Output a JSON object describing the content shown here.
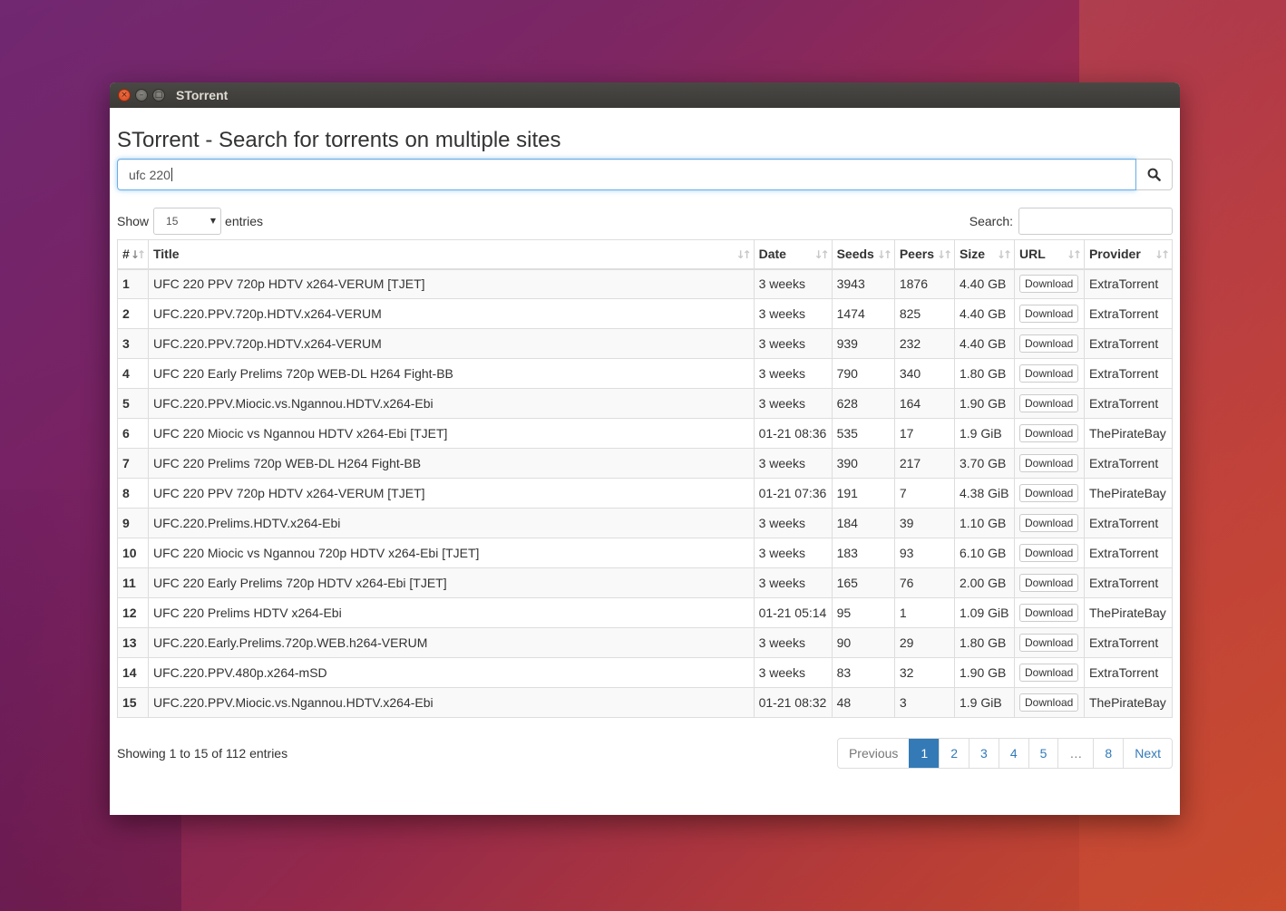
{
  "window": {
    "title": "STorrent",
    "close_glyph": "×",
    "min_glyph": "–",
    "max_glyph": "□"
  },
  "page": {
    "heading": "STorrent - Search for torrents on multiple sites",
    "search_value": "ufc 220",
    "search_icon": "search-icon"
  },
  "controls": {
    "show_label": "Show",
    "entries_value": "15",
    "entries_label": "entries",
    "filter_label": "Search:"
  },
  "table": {
    "headers": [
      "#",
      "Title",
      "Date",
      "Seeds",
      "Peers",
      "Size",
      "URL",
      "Provider"
    ],
    "download_label": "Download",
    "rows": [
      [
        "1",
        "UFC 220 PPV 720p HDTV x264-VERUM [TJET]",
        "3 weeks",
        "3943",
        "1876",
        "4.40 GB",
        "ExtraTorrent"
      ],
      [
        "2",
        "UFC.220.PPV.720p.HDTV.x264-VERUM",
        "3 weeks",
        "1474",
        "825",
        "4.40 GB",
        "ExtraTorrent"
      ],
      [
        "3",
        "UFC.220.PPV.720p.HDTV.x264-VERUM",
        "3 weeks",
        "939",
        "232",
        "4.40 GB",
        "ExtraTorrent"
      ],
      [
        "4",
        "UFC 220 Early Prelims 720p WEB-DL H264 Fight-BB",
        "3 weeks",
        "790",
        "340",
        "1.80 GB",
        "ExtraTorrent"
      ],
      [
        "5",
        "UFC.220.PPV.Miocic.vs.Ngannou.HDTV.x264-Ebi",
        "3 weeks",
        "628",
        "164",
        "1.90 GB",
        "ExtraTorrent"
      ],
      [
        "6",
        "UFC 220 Miocic vs Ngannou HDTV x264-Ebi [TJET]",
        "01-21 08:36",
        "535",
        "17",
        "1.9 GiB",
        "ThePirateBay"
      ],
      [
        "7",
        "UFC 220 Prelims 720p WEB-DL H264 Fight-BB",
        "3 weeks",
        "390",
        "217",
        "3.70 GB",
        "ExtraTorrent"
      ],
      [
        "8",
        "UFC 220 PPV 720p HDTV x264-VERUM [TJET]",
        "01-21 07:36",
        "191",
        "7",
        "4.38 GiB",
        "ThePirateBay"
      ],
      [
        "9",
        "UFC.220.Prelims.HDTV.x264-Ebi",
        "3 weeks",
        "184",
        "39",
        "1.10 GB",
        "ExtraTorrent"
      ],
      [
        "10",
        "UFC 220 Miocic vs Ngannou 720p HDTV x264-Ebi [TJET]",
        "3 weeks",
        "183",
        "93",
        "6.10 GB",
        "ExtraTorrent"
      ],
      [
        "11",
        "UFC 220 Early Prelims 720p HDTV x264-Ebi [TJET]",
        "3 weeks",
        "165",
        "76",
        "2.00 GB",
        "ExtraTorrent"
      ],
      [
        "12",
        "UFC 220 Prelims HDTV x264-Ebi",
        "01-21 05:14",
        "95",
        "1",
        "1.09 GiB",
        "ThePirateBay"
      ],
      [
        "13",
        "UFC.220.Early.Prelims.720p.WEB.h264-VERUM",
        "3 weeks",
        "90",
        "29",
        "1.80 GB",
        "ExtraTorrent"
      ],
      [
        "14",
        "UFC.220.PPV.480p.x264-mSD",
        "3 weeks",
        "83",
        "32",
        "1.90 GB",
        "ExtraTorrent"
      ],
      [
        "15",
        "UFC.220.PPV.Miocic.vs.Ngannou.HDTV.x264-Ebi",
        "01-21 08:32",
        "48",
        "3",
        "1.9 GiB",
        "ThePirateBay"
      ]
    ]
  },
  "footer": {
    "info": "Showing 1 to 15 of 112 entries",
    "pages": [
      {
        "label": "Previous",
        "state": "disabled"
      },
      {
        "label": "1",
        "state": "active"
      },
      {
        "label": "2",
        "state": ""
      },
      {
        "label": "3",
        "state": ""
      },
      {
        "label": "4",
        "state": ""
      },
      {
        "label": "5",
        "state": ""
      },
      {
        "label": "…",
        "state": "disabled"
      },
      {
        "label": "8",
        "state": ""
      },
      {
        "label": "Next",
        "state": ""
      }
    ]
  },
  "colors": {
    "accent": "#337ab7",
    "focus": "#66afe9"
  }
}
